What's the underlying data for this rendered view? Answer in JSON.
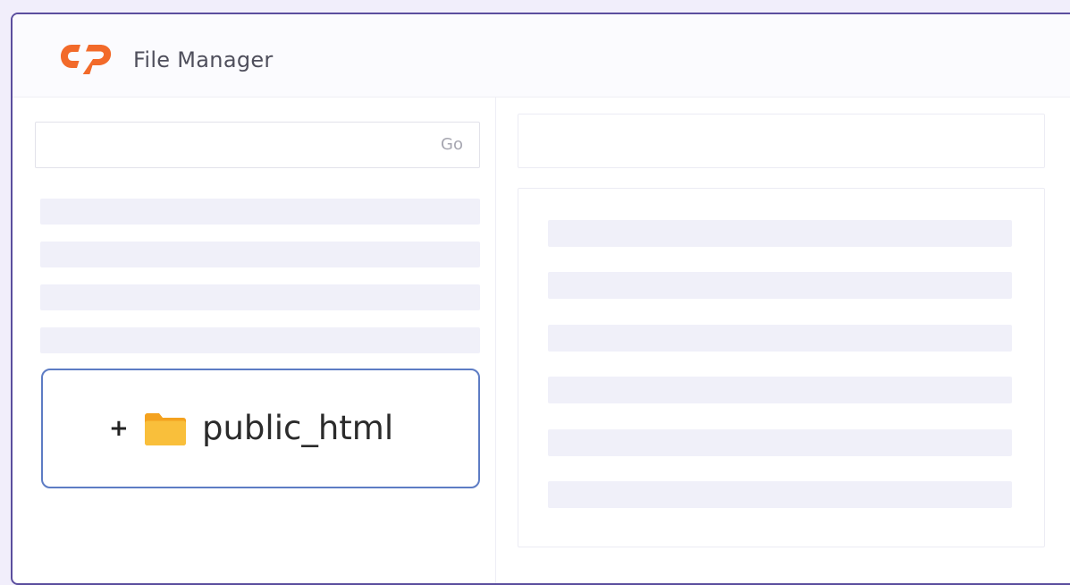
{
  "header": {
    "title": "File Manager",
    "logo_icon": "cpanel-logo-icon",
    "logo_color": "#f26a2a"
  },
  "left_pane": {
    "search": {
      "value": "",
      "placeholder": "",
      "go_label": "Go"
    },
    "skeleton_rows": 4,
    "folder": {
      "expand_symbol": "+",
      "icon": "folder-icon",
      "icon_color": "#f7b731",
      "label": "public_html"
    }
  },
  "right_pane": {
    "skeleton_rows": 6
  },
  "colors": {
    "window_border": "#5b4e9e",
    "skeleton": "#f0f0f9",
    "selection_border": "#5d7cc4"
  }
}
